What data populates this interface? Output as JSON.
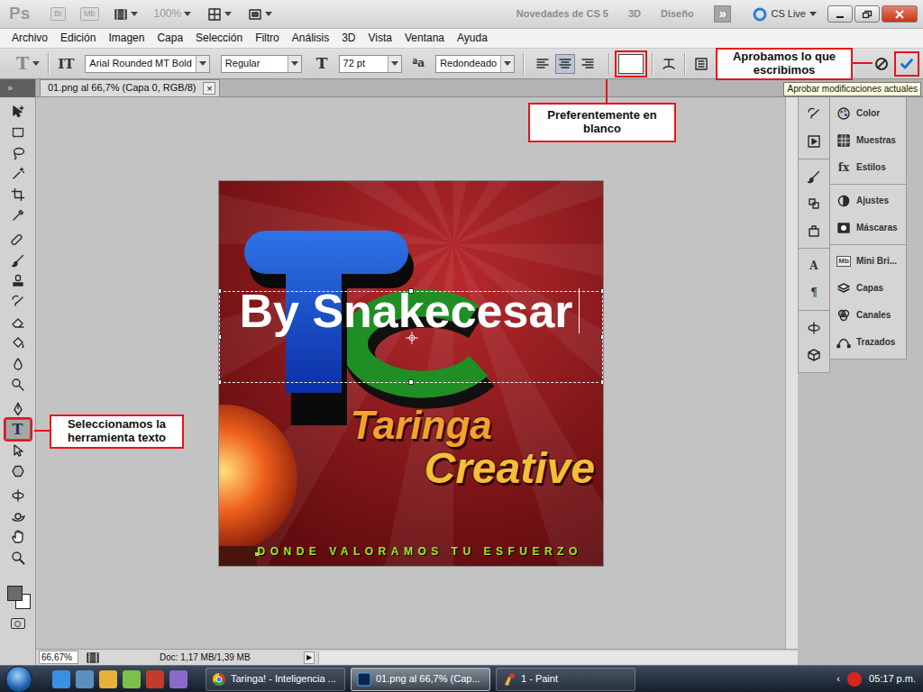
{
  "window": {
    "logo": "Ps",
    "chips": [
      "Br",
      "Mb"
    ],
    "zoom": "100%",
    "workspaces": [
      "Novedades de CS 5",
      "3D",
      "Diseño"
    ],
    "more": "»",
    "cs_live": "CS Live"
  },
  "menu": [
    "Archivo",
    "Edición",
    "Imagen",
    "Capa",
    "Selección",
    "Filtro",
    "Análisis",
    "3D",
    "Vista",
    "Ventana",
    "Ayuda"
  ],
  "options": {
    "preset_glyph": "T",
    "orientation_glyph": "IT",
    "font_family": "Arial Rounded MT Bold",
    "font_style": "Regular",
    "size_glyph": "T",
    "font_size": "72 pt",
    "aa_glyph": "ªa",
    "antialias": "Redondeado",
    "align": [
      {
        "selected": false
      },
      {
        "selected": true
      },
      {
        "selected": false
      }
    ],
    "text_color": "#ffffff"
  },
  "toolbar": {
    "collapse": "»",
    "tools": [
      {
        "kind": "move",
        "selected": false
      },
      {
        "kind": "marquee",
        "selected": false
      },
      {
        "kind": "lasso",
        "selected": false
      },
      {
        "kind": "wand",
        "selected": false
      },
      {
        "kind": "crop",
        "selected": false
      },
      {
        "kind": "eyedropper",
        "selected": false
      },
      {
        "kind": "heal",
        "selected": false
      },
      {
        "kind": "brush",
        "selected": false
      },
      {
        "kind": "stamp",
        "selected": false
      },
      {
        "kind": "history",
        "selected": false
      },
      {
        "kind": "eraser",
        "selected": false
      },
      {
        "kind": "bucket",
        "selected": false
      },
      {
        "kind": "blur",
        "selected": false
      },
      {
        "kind": "dodge",
        "selected": false
      },
      {
        "kind": "pen",
        "selected": false
      },
      {
        "kind": "text",
        "glyph": "T",
        "selected": true
      },
      {
        "kind": "select",
        "selected": false
      },
      {
        "kind": "shape",
        "selected": false
      },
      {
        "kind": "rotate3d",
        "selected": false
      },
      {
        "kind": "orbit3d",
        "selected": false
      },
      {
        "kind": "hand",
        "selected": false
      },
      {
        "kind": "zoom",
        "selected": false
      }
    ]
  },
  "document": {
    "tab": "01.png al 66,7% (Capa 0, RGB/8)",
    "close": "×"
  },
  "canvas": {
    "text_layer": "By Snakecesar",
    "artwork": [
      "Taringa",
      "Creative",
      "DONDE VALORAMOS TU ESFUERZO"
    ]
  },
  "dock": {
    "strip": [
      [
        {
          "kind": "history"
        },
        {
          "kind": "actions"
        }
      ],
      [
        {
          "kind": "brush"
        },
        {
          "kind": "clone"
        },
        {
          "kind": "presets"
        }
      ],
      [
        {
          "kind": "character",
          "glyph": "A"
        },
        {
          "kind": "paragraph",
          "glyph": "¶"
        }
      ],
      [
        {
          "kind": "rotate3d"
        },
        {
          "kind": "box3d"
        }
      ]
    ],
    "panels": [
      [
        {
          "kind": "color",
          "label": "Color"
        },
        {
          "kind": "swatches",
          "label": "Muestras"
        },
        {
          "kind": "styles",
          "glyph": "fx",
          "label": "Estilos"
        }
      ],
      [
        {
          "kind": "adjust",
          "label": "Ajustes"
        },
        {
          "kind": "masks",
          "label": "Máscaras"
        }
      ],
      [
        {
          "kind": "minibridge",
          "glyph": "Mb",
          "label": "Mini Bri..."
        },
        {
          "kind": "layers",
          "label": "Capas"
        },
        {
          "kind": "channels",
          "label": "Canales"
        },
        {
          "kind": "paths",
          "label": "Trazados"
        }
      ]
    ]
  },
  "status_bar": {
    "zoom": "66,67%",
    "doc": "Doc: 1,17 MB/1,39 MB",
    "arrow": "▶"
  },
  "taskbar": {
    "items": [
      {
        "kind": "chrome",
        "label": "Taringa! - Inteligencia ...",
        "selected": false
      },
      {
        "kind": "photoshop",
        "label": "01.png al 66,7% (Cap...",
        "selected": true
      },
      {
        "kind": "paint",
        "label": "1 - Paint",
        "selected": false
      }
    ],
    "arrow": "‹",
    "clock": "05:17 p.m."
  },
  "annotations": {
    "commit": "Aprobamos lo que escribimos",
    "tooltip": "Aprobar modificaciones actuales",
    "color": "Preferentemente en blanco",
    "tool": "Seleccionamos la herramienta texto"
  }
}
